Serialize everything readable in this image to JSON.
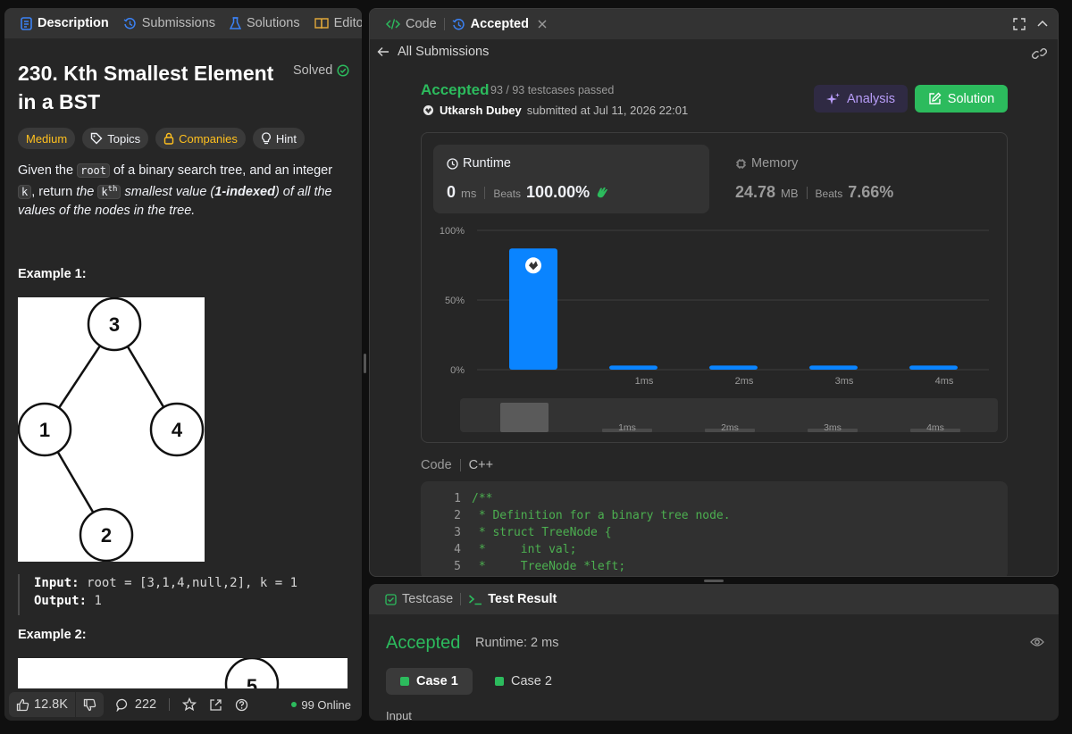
{
  "left_tabs": [
    {
      "label": "Description",
      "active": true
    },
    {
      "label": "Submissions",
      "active": false
    },
    {
      "label": "Solutions",
      "active": false
    },
    {
      "label": "Edito",
      "active": false
    }
  ],
  "problem": {
    "title": "230. Kth Smallest Element in a BST",
    "status": "Solved",
    "difficulty": "Medium",
    "chips": [
      "Topics",
      "Companies",
      "Hint"
    ],
    "desc_parts": {
      "p1": "Given the ",
      "root": "root",
      "p2": " of a binary search tree, and an integer ",
      "k": "k",
      "p3": ", return ",
      "the": "the",
      "kth_k": "k",
      "kth_th": "th",
      "p4": " smallest value (",
      "idx": "1-indexed",
      "p5": ") of all the values of the nodes in the tree."
    },
    "example1_title": "Example 1:",
    "example1_nodes": [
      "3",
      "1",
      "4",
      "2"
    ],
    "example1_input_label": "Input:",
    "example1_input": "root = [3,1,4,null,2], k = 1",
    "example1_output_label": "Output:",
    "example1_output": "1",
    "example2_title": "Example 2:",
    "example2_node": "5"
  },
  "left_footer": {
    "likes": "12.8K",
    "comments": "222",
    "online": "99 Online"
  },
  "right_tabs": [
    {
      "label": "Code",
      "active": false
    },
    {
      "label": "Accepted",
      "active": true
    }
  ],
  "submission": {
    "back_label": "All Submissions",
    "status": "Accepted",
    "testcases": "93 / 93 testcases passed",
    "author": "Utkarsh Dubey",
    "submitted_at": "submitted at Jul 11, 2026 22:01",
    "analysis_label": "Analysis",
    "solution_label": "Solution",
    "runtime_label": "Runtime",
    "runtime_value": "0",
    "runtime_unit": "ms",
    "beats_label": "Beats",
    "runtime_beats": "100.00%",
    "memory_label": "Memory",
    "memory_value": "24.78",
    "memory_unit": "MB",
    "memory_beats": "7.66%",
    "code_label": "Code",
    "language": "C++",
    "code_lines": [
      {
        "n": "1",
        "t": "/**"
      },
      {
        "n": "2",
        "t": " * Definition for a binary tree node."
      },
      {
        "n": "3",
        "t": " * struct TreeNode {"
      },
      {
        "n": "4",
        "t": " *     int val;"
      },
      {
        "n": "5",
        "t": " *     TreeNode *left;"
      }
    ]
  },
  "chart_data": {
    "type": "bar",
    "categories": [
      "",
      "1ms",
      "2ms",
      "3ms",
      "4ms"
    ],
    "values": [
      87,
      3,
      3,
      3,
      3
    ],
    "ylim": [
      0,
      100
    ],
    "ytick_labels": [
      "100%",
      "50%",
      "0%"
    ],
    "highlight_index": 0,
    "bar_color": "#0a84ff",
    "mini_labels": [
      "1ms",
      "2ms",
      "3ms",
      "4ms"
    ]
  },
  "bottom": {
    "tabs": [
      {
        "label": "Testcase",
        "active": false
      },
      {
        "label": "Test Result",
        "active": true
      }
    ],
    "status": "Accepted",
    "runtime": "Runtime: 2 ms",
    "cases": [
      "Case 1",
      "Case 2"
    ],
    "input_label": "Input"
  },
  "colors": {
    "accent_green": "#2cbb5d",
    "medium_yellow": "#ffc01e",
    "bar_blue": "#0a84ff",
    "analysis_purple": "#b79cf7"
  }
}
